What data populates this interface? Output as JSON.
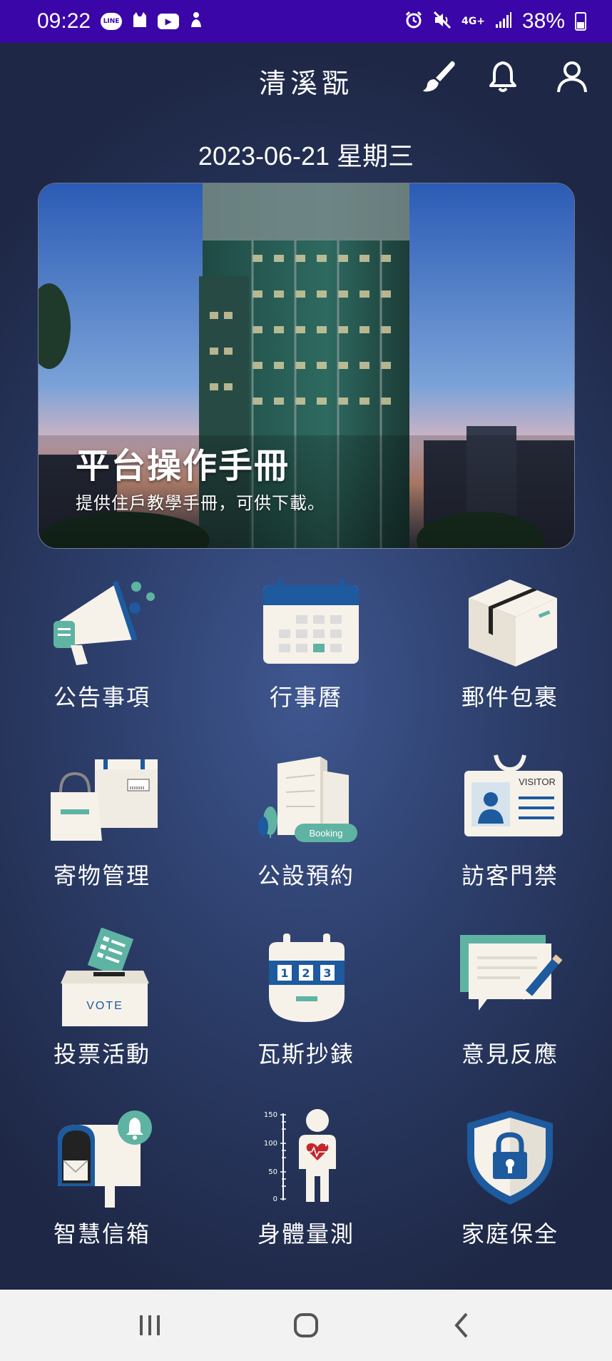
{
  "status_bar": {
    "time": "09:22",
    "battery": "38%",
    "left_icons": [
      "line-icon",
      "cat-icon",
      "youtube-icon",
      "person-icon"
    ],
    "right_icons": [
      "alarm-icon",
      "mute-icon",
      "4g-icon",
      "signal-icon",
      "battery-icon"
    ],
    "network_label": "4G+"
  },
  "header": {
    "title": "清溪翫",
    "icons": [
      "brush-icon",
      "bell-icon",
      "user-icon"
    ]
  },
  "date": "2023-06-21 星期三",
  "banner": {
    "title": "平台操作手冊",
    "subtitle": "提供住戶教學手冊，可供下載。"
  },
  "menu": [
    {
      "label": "公告事項",
      "icon": "megaphone-icon"
    },
    {
      "label": "行事曆",
      "icon": "calendar-icon"
    },
    {
      "label": "郵件包裹",
      "icon": "package-icon"
    },
    {
      "label": "寄物管理",
      "icon": "storage-bags-icon"
    },
    {
      "label": "公設預約",
      "icon": "facility-booking-icon",
      "badge": "Booking"
    },
    {
      "label": "訪客門禁",
      "icon": "visitor-badge-icon",
      "badge": "VISITOR"
    },
    {
      "label": "投票活動",
      "icon": "ballot-box-icon",
      "badge": "VOTE"
    },
    {
      "label": "瓦斯抄錶",
      "icon": "gas-meter-icon",
      "digits": [
        "1",
        "2",
        "3"
      ]
    },
    {
      "label": "意見反應",
      "icon": "feedback-icon"
    },
    {
      "label": "智慧信箱",
      "icon": "smart-mailbox-icon"
    },
    {
      "label": "身體量測",
      "icon": "body-measurement-icon",
      "scale": [
        "150",
        "100",
        "50",
        "0"
      ]
    },
    {
      "label": "家庭保全",
      "icon": "security-shield-icon"
    }
  ],
  "nav_bar": {
    "icons": [
      "recent-apps-icon",
      "home-icon",
      "back-icon"
    ]
  },
  "colors": {
    "status_bar": "#3b06a8",
    "background": "#1f2a4d",
    "accent_teal": "#5fb3a3",
    "accent_blue": "#1d5a9e"
  }
}
